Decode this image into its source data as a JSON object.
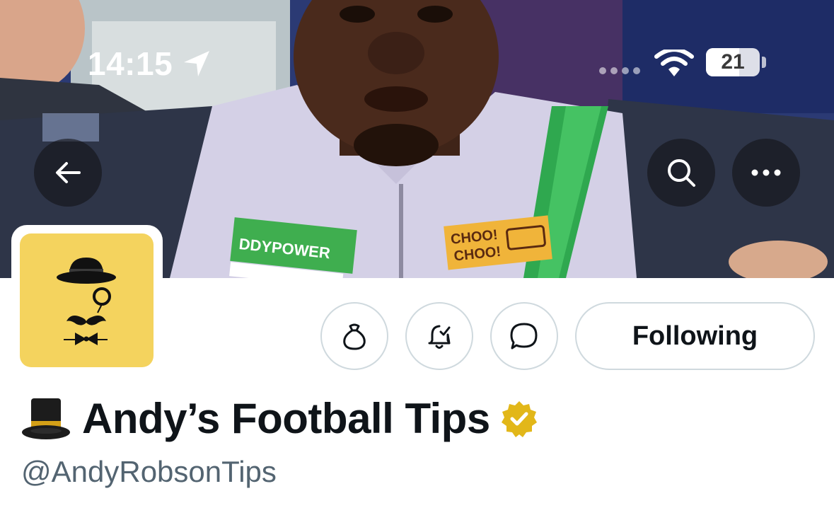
{
  "status_bar": {
    "time": "14:15",
    "battery": "21",
    "icons": [
      "location-arrow-icon",
      "cellular-signal-icon",
      "wifi-icon",
      "battery-icon"
    ]
  },
  "header": {
    "banner_patch_texts": {
      "sponsor": "DDYPOWER",
      "badge_line1": "CHOO!",
      "badge_line2": "CHOO!"
    },
    "nav_icons": [
      "back-arrow-icon",
      "search-icon",
      "more-icon"
    ]
  },
  "profile": {
    "display_name": "Andy’s Football Tips",
    "handle": "@AndyRobsonTips",
    "name_emoji": "top-hat-emoji",
    "verified": "gold-verified-badge-icon",
    "following_label": "Following",
    "action_icons": [
      "tip-jar-icon",
      "notification-bell-icon",
      "message-icon"
    ]
  },
  "colors": {
    "avatar_bg": "#f4d35e",
    "verified_gold": "#e2b719",
    "handle_gray": "#536471",
    "button_border": "#cfd9de",
    "text_primary": "#0f1419"
  }
}
